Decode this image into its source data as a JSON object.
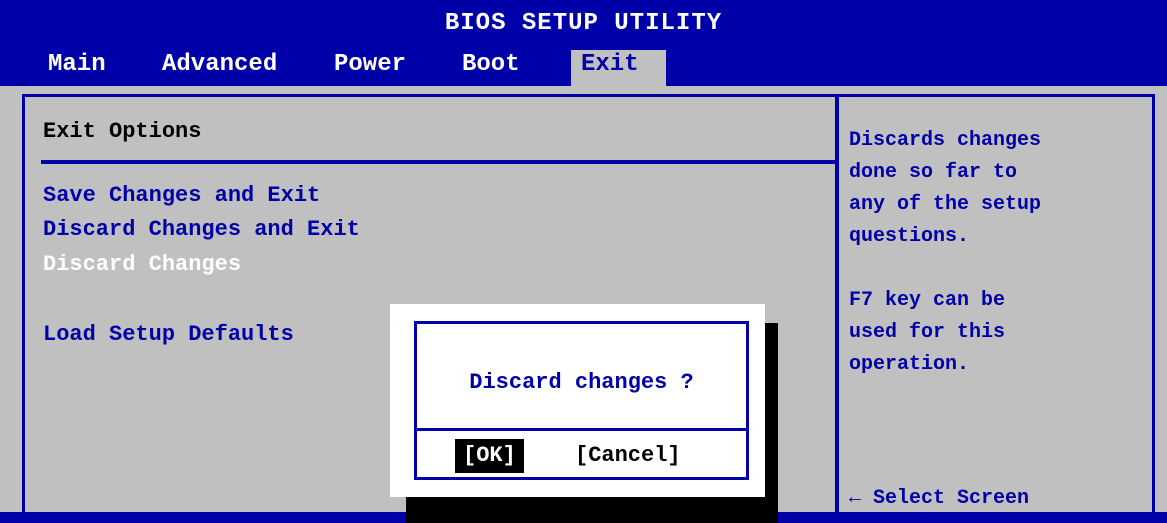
{
  "app": {
    "title": "BIOS SETUP UTILITY"
  },
  "tabs": [
    {
      "label": "Main",
      "active": false
    },
    {
      "label": "Advanced",
      "active": false
    },
    {
      "label": "Power",
      "active": false
    },
    {
      "label": "Boot",
      "active": false
    },
    {
      "label": "Exit",
      "active": true
    }
  ],
  "main": {
    "section_title": "Exit Options",
    "items": [
      {
        "label": "Save Changes and Exit",
        "selected": false
      },
      {
        "label": "Discard Changes and Exit",
        "selected": false
      },
      {
        "label": "Discard Changes",
        "selected": true
      },
      {
        "label": "Load Setup Defaults",
        "selected": false
      }
    ]
  },
  "help": {
    "lines": [
      "Discards changes",
      "done so far to",
      "any of the setup",
      "questions.",
      "",
      "F7 key can be",
      "used for this",
      "operation."
    ],
    "nav_hint": "← Select Screen",
    "nav_icon": "left-arrow-icon"
  },
  "dialog": {
    "message": "Discard changes ?",
    "ok_label": "[OK]",
    "cancel_label": "[Cancel]",
    "focused": "ok"
  },
  "colors": {
    "background": "#0000a8",
    "panel": "#c0c0c0",
    "text_highlight": "#ffffff",
    "dialog_bg": "#ffffff"
  }
}
